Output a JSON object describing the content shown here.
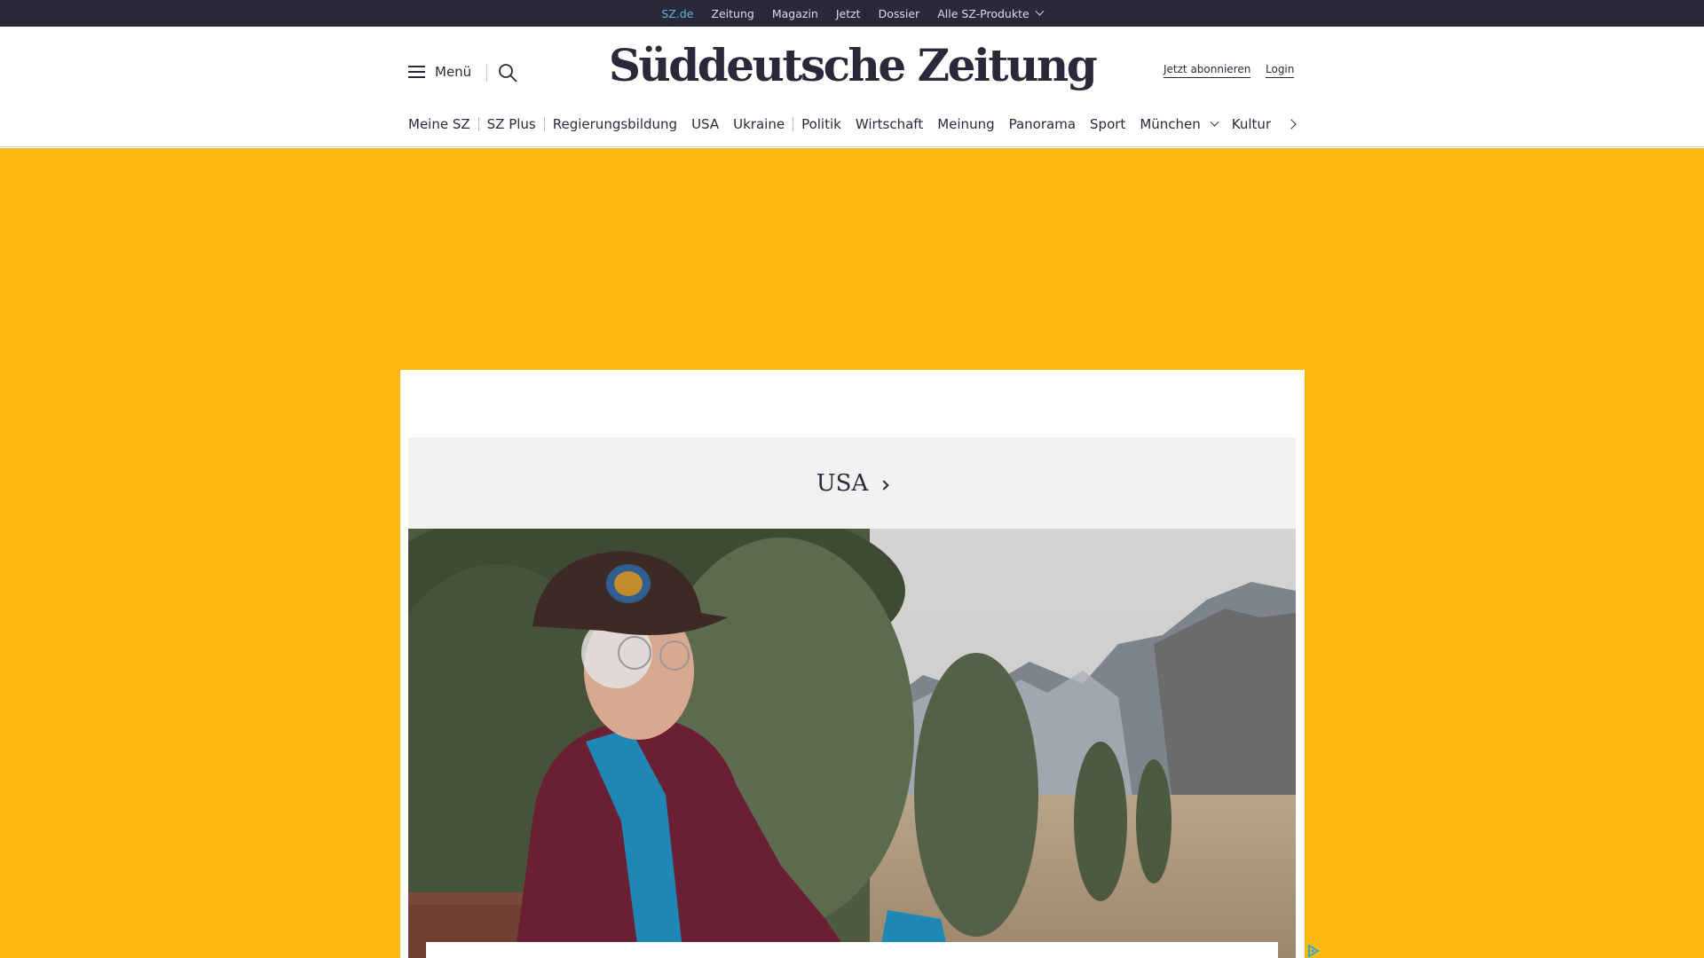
{
  "topbar": {
    "links": [
      {
        "label": "SZ.de",
        "active": true
      },
      {
        "label": "Zeitung"
      },
      {
        "label": "Magazin"
      },
      {
        "label": "Jetzt"
      },
      {
        "label": "Dossier"
      },
      {
        "label": "Alle SZ-Produkte",
        "dropdown": true
      }
    ]
  },
  "header": {
    "menu_label": "Menü",
    "logo_text": "Süddeutsche Zeitung",
    "subscribe_label": "Jetzt abonnieren",
    "login_label": "Login"
  },
  "nav": {
    "items": [
      "Meine SZ",
      "SZ Plus",
      "Regierungsbildung",
      "USA",
      "Ukraine",
      "Politik",
      "Wirtschaft",
      "Meinung",
      "Panorama",
      "Sport",
      "München",
      "Kultur"
    ]
  },
  "section": {
    "title": "USA"
  },
  "colors": {
    "topbar_bg": "#29293a",
    "active_link": "#5fb6d6",
    "ad_background": "#fdb913",
    "text": "#29293a",
    "section_bg": "#f1f1f1"
  },
  "icons": {
    "menu": "hamburger-icon",
    "search": "search-icon",
    "nav_more": "chevron-right-icon",
    "dropdown": "chevron-down-icon",
    "ad": "adchoices-icon"
  }
}
